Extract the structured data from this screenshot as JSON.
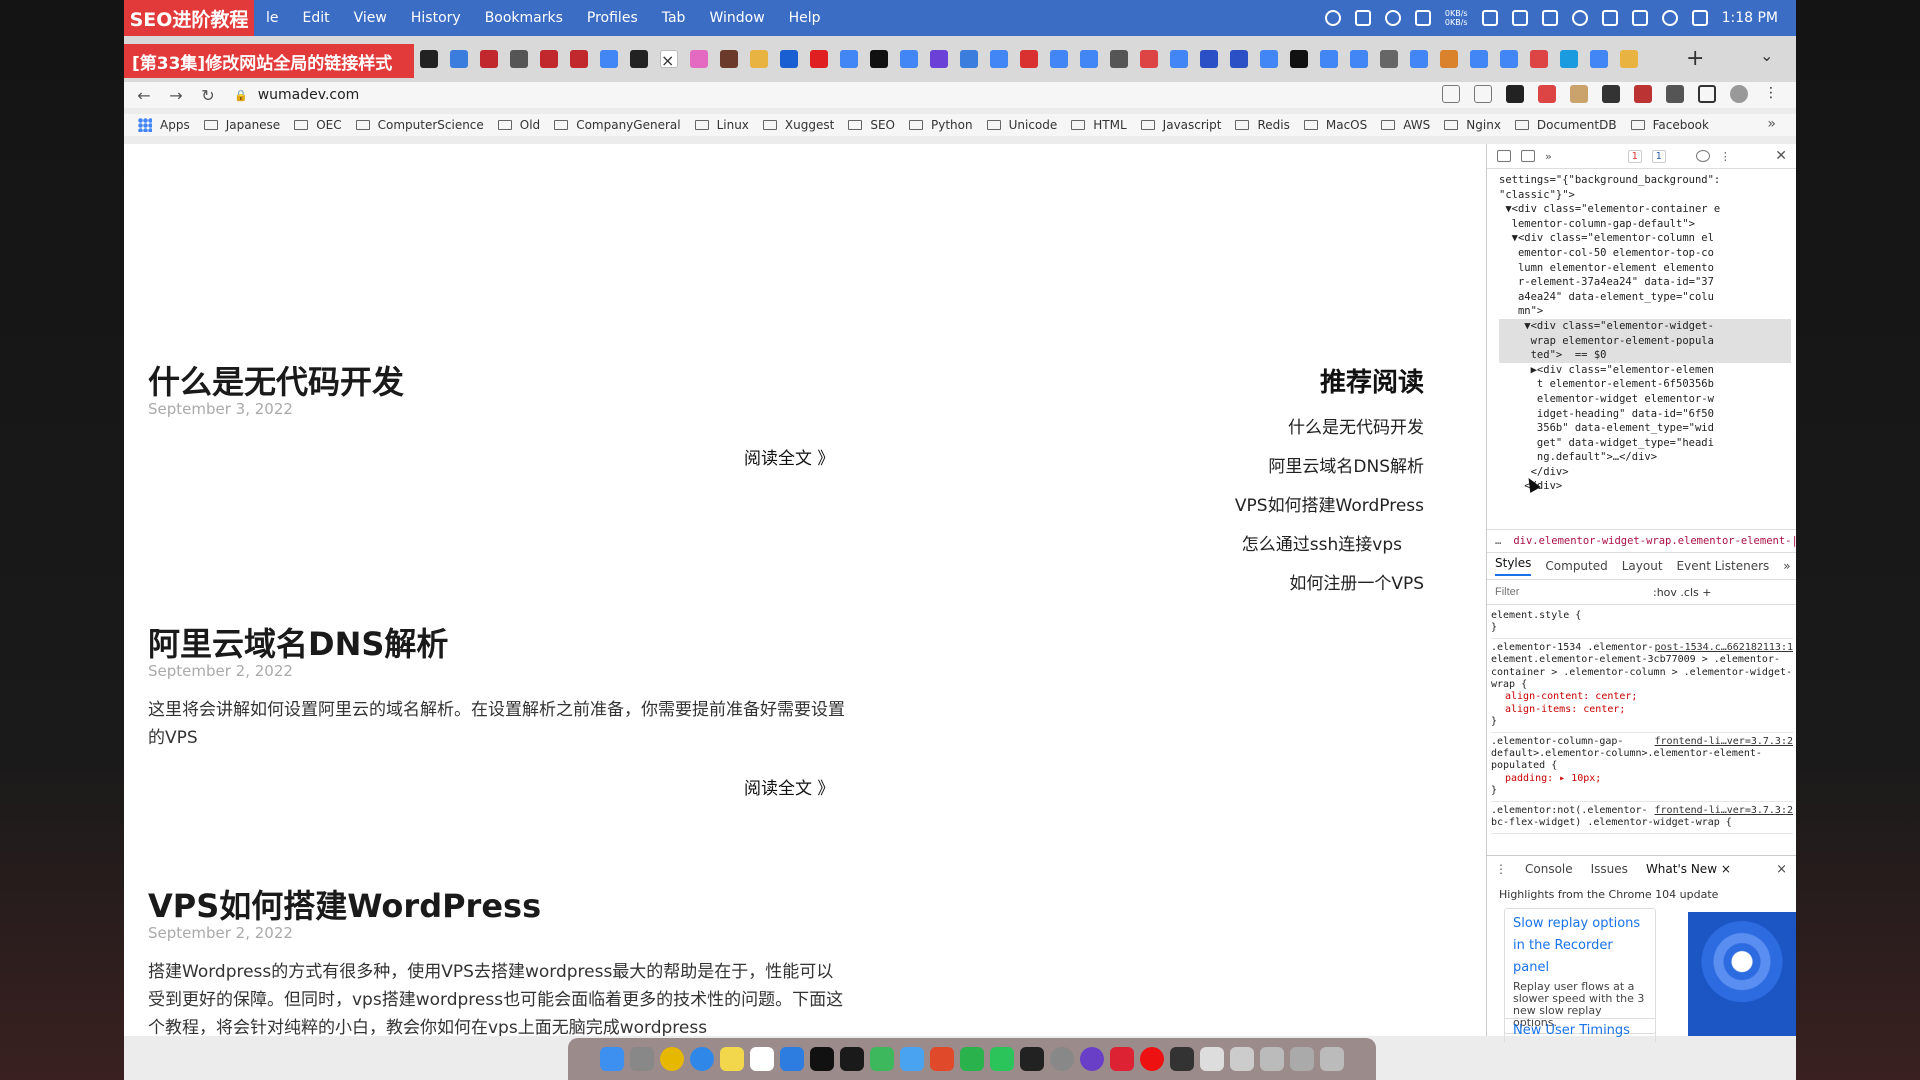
{
  "branding": {
    "badge": "SEO进阶教程",
    "banner": "[第33集]修改网站全局的链接样式"
  },
  "menubar": {
    "items": [
      "le",
      "Edit",
      "View",
      "History",
      "Bookmarks",
      "Profiles",
      "Tab",
      "Window",
      "Help"
    ],
    "net_up": "0KB/s",
    "net_down": "0KB/s",
    "clock": "1:18 PM"
  },
  "tabs": {
    "close_glyph": "×",
    "new_tab": "+",
    "menu": "⌄"
  },
  "toolbar": {
    "back": "←",
    "forward": "→",
    "reload": "↻",
    "url": "wumadev.com"
  },
  "bookmarks": {
    "apps_label": "Apps",
    "items": [
      "Japanese",
      "OEC",
      "ComputerScience",
      "Old",
      "CompanyGeneral",
      "Linux",
      "Xuggest",
      "SEO",
      "Python",
      "Unicode",
      "HTML",
      "Javascript",
      "Redis",
      "MacOS",
      "AWS",
      "Nginx",
      "DocumentDB",
      "Facebook"
    ],
    "more": "»"
  },
  "posts": [
    {
      "title": "什么是无代码开发",
      "date": "September 3, 2022",
      "excerpt": "",
      "read_more": "阅读全文 》"
    },
    {
      "title": "阿里云域名DNS解析",
      "date": "September 2, 2022",
      "excerpt": "这里将会讲解如何设置阿里云的域名解析。在设置解析之前准备，你需要提前准备好需要设置的VPS",
      "read_more": "阅读全文 》"
    },
    {
      "title": "VPS如何搭建WordPress",
      "date": "September 2, 2022",
      "excerpt": "搭建Wordpress的方式有很多种，使用VPS去搭建wordpress最大的帮助是在于，性能可以受到更好的保障。但同时，vps搭建wordpress也可能会面临着更多的技术性的问题。下面这个教程，将会针对纯粹的小白，教会你如何在vps上面无脑完成wordpress",
      "read_more": ""
    }
  ],
  "sidebar": {
    "title": "推荐阅读",
    "links": [
      "什么是无代码开发",
      "阿里云域名DNS解析",
      "VPS如何搭建WordPress",
      "怎么通过ssh连接vps",
      "如何注册一个VPS"
    ]
  },
  "devtools": {
    "errors": "1",
    "messages": "1",
    "more_panels": "»",
    "dom_lines": [
      "settings=\"{\"background_background\":",
      "\"classic\"}\">",
      " ▼<div class=\"elementor-container e",
      "  lementor-column-gap-default\">",
      "  ▼<div class=\"elementor-column el",
      "   ementor-col-50 elementor-top-co",
      "   lumn elementor-element elemento",
      "   r-element-37a4ea24\" data-id=\"37",
      "   a4ea24\" data-element_type=\"colu",
      "   mn\">",
      "    ▼<div class=\"elementor-widget-",
      "     wrap elementor-element-popula",
      "     ted\">  == $0",
      "     ▶<div class=\"elementor-elemen",
      "      t elementor-element-6f50356b",
      "      elementor-widget elementor-w",
      "      idget-heading\" data-id=\"6f50",
      "      356b\" data-element_type=\"wid",
      "      get\" data-widget_type=\"headi",
      "      ng.default\">…</div>",
      "     </div>",
      "    </div>"
    ],
    "dom_ellipsis": "…",
    "breadcrumb": "div.elementor-widget-wrap.elementor-element-|",
    "breadcrumb_more": "…",
    "tabs": [
      "Styles",
      "Computed",
      "Layout",
      "Event Listeners"
    ],
    "filter_placeholder": "Filter",
    "filter_opts": ":hov  .cls  +",
    "rules": [
      {
        "selector": "element.style {",
        "source": "",
        "props": [],
        "close": "}"
      },
      {
        "selector": ".elementor-1534 .elementor-element.elementor-element-3cb77009 > .elementor-container > .elementor-column > .elementor-widget-wrap {",
        "source": "post-1534.c…662182113:1",
        "props": [
          "align-content: center;",
          "align-items: center;"
        ],
        "close": "}"
      },
      {
        "selector": ".elementor-column-gap-default>.elementor-column>.elementor-element-populated {",
        "source": "frontend-li…ver=3.7.3:2",
        "props": [
          "padding: ▸ 10px;"
        ],
        "close": "}"
      },
      {
        "selector": ".elementor:not(.elementor-bc-flex-widget) .elementor-widget-wrap {",
        "source": "frontend-li…ver=3.7.3:2",
        "props": [],
        "close": ""
      }
    ],
    "drawer_tabs": [
      "Console",
      "Issues",
      "What's New ×"
    ],
    "drawer_close": "×",
    "whats_new_heading": "Highlights from the Chrome 104 update",
    "card_title": "Slow replay options in the Recorder panel",
    "card_desc": "Replay user flows at a slower speed with the 3 new slow replay options.",
    "card_next": "New User Timings"
  },
  "colors": {
    "menubar": "#3b6dc5",
    "brand_red": "#e23a3a",
    "link_blue": "#1a73e8"
  }
}
